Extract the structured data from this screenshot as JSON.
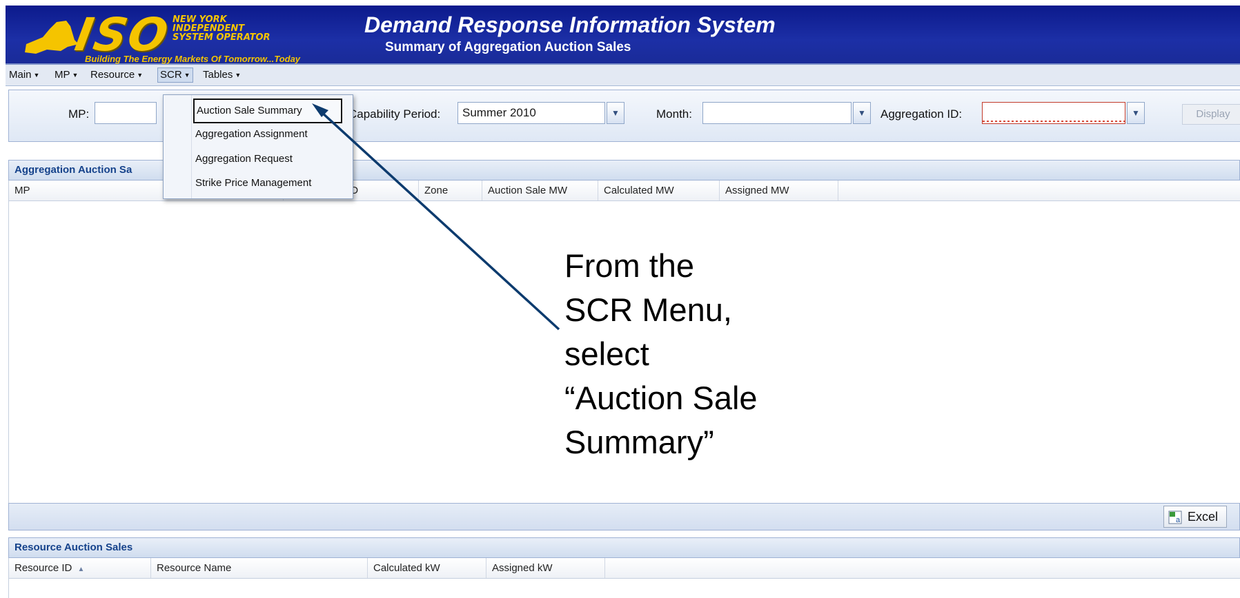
{
  "header": {
    "logo_text": "ISO",
    "org_name_lines": [
      "NEW YORK",
      "INDEPENDENT",
      "SYSTEM OPERATOR"
    ],
    "tagline": "Building The Energy Markets Of Tomorrow...Today",
    "title": "Demand Response Information System",
    "subtitle": "Summary of Aggregation Auction Sales"
  },
  "menubar": {
    "items": [
      {
        "label": "Main"
      },
      {
        "label": "MP"
      },
      {
        "label": "Resource"
      },
      {
        "label": "SCR",
        "active": true
      },
      {
        "label": "Tables"
      }
    ]
  },
  "scr_dropdown": {
    "items": [
      {
        "label": "Auction Sale Summary",
        "highlighted": true
      },
      {
        "label": "Aggregation Assignment"
      },
      {
        "label": "Aggregation Request"
      },
      {
        "label": "Strike Price Management"
      }
    ]
  },
  "filters": {
    "mp_label": "MP:",
    "mp_value": "",
    "capability_period_label": "Capability Period:",
    "capability_period_value": "Summer 2010",
    "month_label": "Month:",
    "month_value": "",
    "aggregation_id_label": "Aggregation ID:",
    "aggregation_id_value": "",
    "display_button": "Display"
  },
  "aggregation_panel": {
    "title": "Aggregation Auction Sa",
    "columns": [
      "MP",
      "Aggregation ID",
      "Zone",
      "Auction Sale MW",
      "Calculated MW",
      "Assigned MW"
    ],
    "excel_button": "Excel"
  },
  "resource_panel": {
    "title": "Resource Auction Sales",
    "columns": [
      "Resource ID",
      "Resource Name",
      "Calculated kW",
      "Assigned kW"
    ],
    "sort_indicator": "▲"
  },
  "callout": {
    "lines": [
      "From the",
      "SCR Menu,",
      "select",
      "“Auction Sale",
      "Summary”"
    ]
  },
  "colors": {
    "header_blue": "#1c2fa6",
    "logo_gold": "#f5c400",
    "panel_title_text": "#15428b",
    "arrow": "#0d3b6e"
  }
}
